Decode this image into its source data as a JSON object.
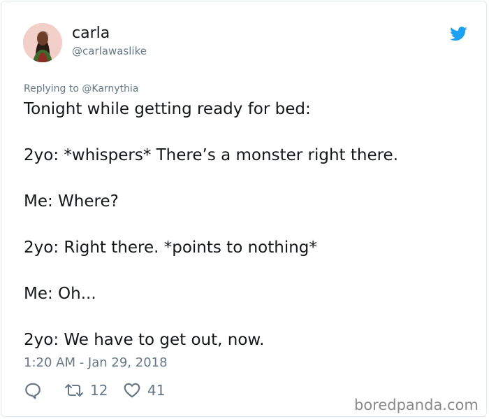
{
  "tweet": {
    "display_name": "carla",
    "handle": "@carlawaslike",
    "replying_prefix": "Replying to ",
    "replying_to": "@Karnythia",
    "text_lines": [
      "Tonight while getting ready for bed:",
      "2yo: *whispers* There’s a monster right there.",
      "Me: Where?",
      "2yo: Right there. *points to nothing*",
      "Me: Oh...",
      "2yo: We have to get out, now."
    ],
    "timestamp": "1:20 AM - Jan 29, 2018",
    "actions": {
      "reply_icon": "reply-icon",
      "retweet_icon": "retweet-icon",
      "retweet_count": "12",
      "like_icon": "heart-icon",
      "like_count": "41"
    }
  },
  "watermark": "boredpanda.com",
  "colors": {
    "twitter_blue": "#1da1f2",
    "text_primary": "#14171a",
    "text_secondary": "#657786",
    "border": "#e1e8ed"
  }
}
